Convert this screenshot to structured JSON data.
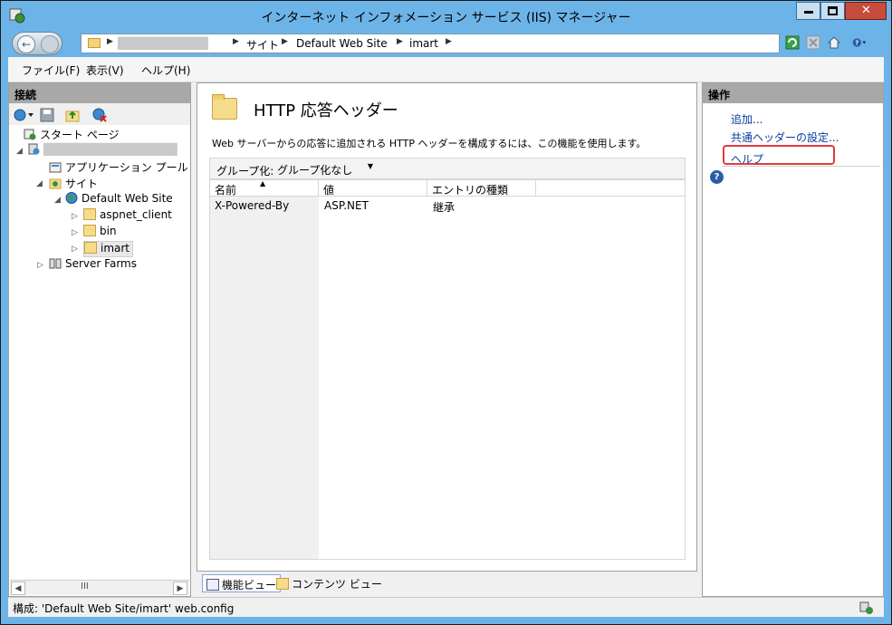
{
  "window": {
    "title": "インターネット インフォメーション サービス (IIS) マネージャー",
    "minimize_label": "—",
    "maximize_label": "□",
    "close_label": "✕"
  },
  "navbar": {
    "back_glyph": "←",
    "breadcrumbs": [
      "████████████",
      "サイト",
      "Default Web Site",
      "imart"
    ],
    "crumb_separator": "▶"
  },
  "menu": {
    "items": [
      "ファイル(F)",
      "表示(V)",
      "ヘルプ(H)"
    ]
  },
  "left_panel": {
    "header": "接続",
    "tree": [
      {
        "label": "スタート ページ",
        "icon": "start-page-icon"
      },
      {
        "label": "████████████████",
        "icon": "server-icon"
      },
      {
        "label": "アプリケーション プール",
        "icon": "app-pool-icon"
      },
      {
        "label": "サイト",
        "icon": "sites-icon"
      },
      {
        "label": "Default Web Site",
        "icon": "globe-icon"
      },
      {
        "label": "aspnet_client",
        "icon": "folder-icon"
      },
      {
        "label": "bin",
        "icon": "folder-icon"
      },
      {
        "label": "imart",
        "icon": "folder-icon"
      },
      {
        "label": "Server Farms",
        "icon": "server-farms-icon"
      }
    ],
    "scroll_thumb": "III"
  },
  "center": {
    "title": "HTTP 応答ヘッダー",
    "description": "Web サーバーからの応答に追加される HTTP ヘッダーを構成するには、この機能を使用します。",
    "group_label": "グループ化:",
    "group_value": "グループ化なし",
    "columns": [
      "名前",
      "値",
      "エントリの種類"
    ],
    "rows": [
      {
        "name": "X-Powered-By",
        "value": "ASP.NET",
        "entry_type": "継承"
      }
    ],
    "tabs": [
      "機能ビュー",
      "コンテンツ ビュー"
    ]
  },
  "right_panel": {
    "header": "操作",
    "actions": [
      "追加...",
      "共通ヘッダーの設定...",
      "ヘルプ"
    ]
  },
  "status": {
    "text": "構成: 'Default Web Site/imart' web.config"
  },
  "colors": {
    "title_bar": "#6cb4e8",
    "panel_header": "#a8a8a8",
    "link": "#0a3c9e",
    "highlight": "#e03b3b"
  }
}
